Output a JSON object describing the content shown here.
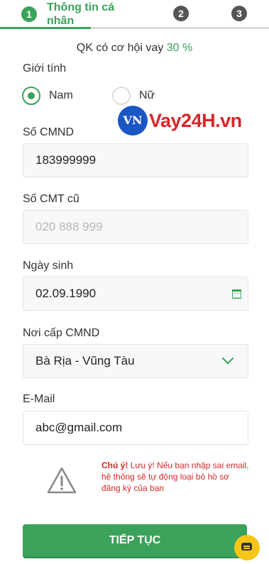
{
  "stepper": {
    "steps": [
      {
        "number": "1",
        "label": "Thông tin cá nhân"
      },
      {
        "number": "2"
      },
      {
        "number": "3"
      }
    ]
  },
  "subtitle": {
    "text": "QK có cơ hội vay",
    "percent": "30 %"
  },
  "gender": {
    "label": "Giới tính",
    "options": [
      {
        "label": "Nam",
        "selected": true
      },
      {
        "label": "Nữ",
        "selected": false
      }
    ]
  },
  "watermark": {
    "badge": "VN",
    "text": "Vay24H.vn"
  },
  "id_number": {
    "label": "Số CMND",
    "value": "183999999"
  },
  "old_id": {
    "label": "Số CMT cũ",
    "placeholder": "020 888 999"
  },
  "birthday": {
    "label": "Ngày sinh",
    "value": "02.09.1990",
    "icon": "calendar-icon"
  },
  "issue_place": {
    "label": "Nơi cấp CMND",
    "value": "Bà Rịa - Vũng Tàu",
    "icon": "chevron-down-icon"
  },
  "email": {
    "label": "E-Mail",
    "value": "abc@gmail.com"
  },
  "warning": {
    "icon": "warning-triangle-icon",
    "strong": "Chú ý!",
    "text": "Lưu ý! Nếu bạn nhập sai email, hệ thống sẽ tự động loại bỏ hồ sơ đăng ký của bạn"
  },
  "submit_label": "TIẾP TỤC",
  "chat": {
    "icon": "chat-bubble-icon"
  },
  "colors": {
    "accent": "#3aa25a",
    "warning": "#d8262a",
    "chat": "#f5c518"
  }
}
